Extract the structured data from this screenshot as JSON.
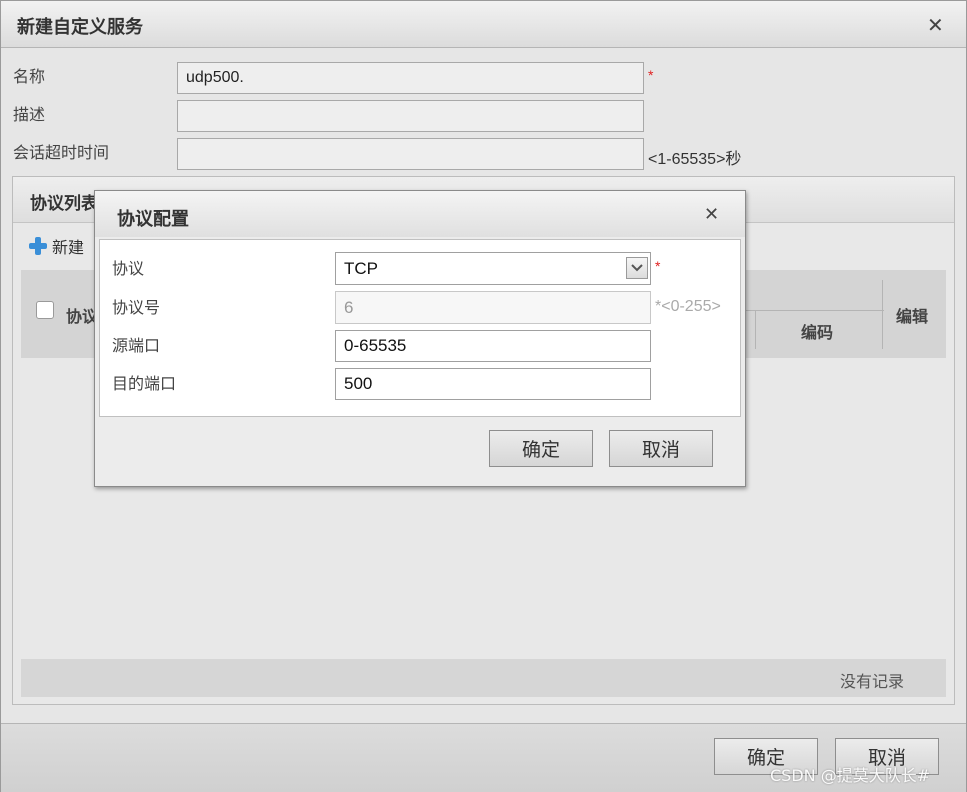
{
  "window": {
    "title": "新建自定义服务",
    "fields": {
      "name": {
        "label": "名称",
        "value": "udp500."
      },
      "description": {
        "label": "描述",
        "value": ""
      },
      "timeout": {
        "label": "会话超时时间",
        "value": "",
        "hint": "<1-65535>秒"
      }
    },
    "required_mark": "*",
    "protocol_list": {
      "title": "协议列表",
      "new_label": "新建",
      "columns": {
        "protocol": "协议",
        "code": "编码",
        "edit": "编辑"
      },
      "empty_text": "没有记录"
    },
    "ok_label": "确定",
    "cancel_label": "取消"
  },
  "dialog": {
    "title": "协议配置",
    "fields": {
      "protocol": {
        "label": "协议",
        "value": "TCP"
      },
      "protocol_number": {
        "label": "协议号",
        "value": "6",
        "hint": "*<0-255>"
      },
      "src_port": {
        "label": "源端口",
        "value": "0-65535"
      },
      "dst_port": {
        "label": "目的端口",
        "value": "500"
      }
    },
    "required_mark": "*",
    "ok_label": "确定",
    "cancel_label": "取消"
  },
  "watermark": "CSDN @提莫大队长#",
  "icons": {
    "close": "close-icon",
    "add": "plus-icon",
    "dropdown": "chevron-down-icon"
  },
  "colors": {
    "accent": "#3a8fd8",
    "required": "#e02020"
  }
}
